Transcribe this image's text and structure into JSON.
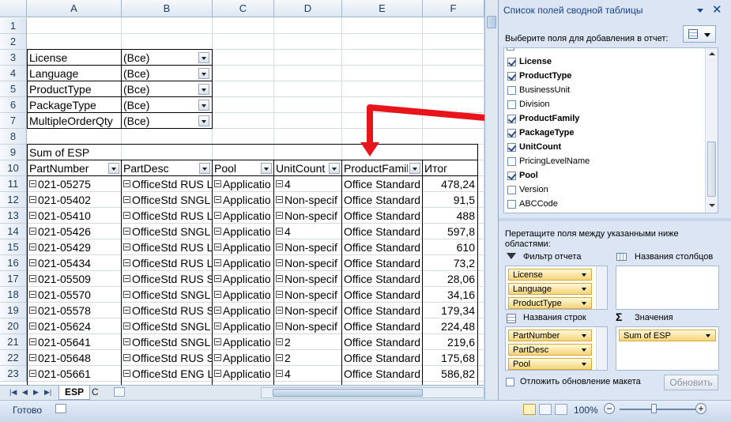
{
  "columns": [
    "A",
    "B",
    "C",
    "D",
    "E",
    "F"
  ],
  "row_numbers": [
    "1",
    "2",
    "3",
    "4",
    "5",
    "6",
    "7",
    "8",
    "9",
    "10",
    "11",
    "12",
    "13",
    "14",
    "15",
    "16",
    "17",
    "18",
    "19",
    "20",
    "21",
    "22",
    "23"
  ],
  "filters": [
    {
      "name": "License",
      "value": "(Все)"
    },
    {
      "name": "Language",
      "value": "(Все)"
    },
    {
      "name": "ProductType",
      "value": "(Все)"
    },
    {
      "name": "PackageType",
      "value": "(Все)"
    },
    {
      "name": "MultipleOrderQty",
      "value": "(Все)"
    }
  ],
  "pivot": {
    "data_caption": "Sum of ESP",
    "headers": [
      "PartNumber",
      "PartDesc",
      "Pool",
      "UnitCount",
      "ProductFamil",
      "Итог"
    ],
    "rows": [
      {
        "part": "021-05275",
        "desc": "OfficeStd RUS Li",
        "pool": "Applicatio",
        "unit": "4",
        "family": "Office Standard",
        "total": "478,24"
      },
      {
        "part": "021-05402",
        "desc": "OfficeStd SNGL I",
        "pool": "Applicatio",
        "unit": "Non-specif",
        "family": "Office Standard",
        "total": "91,5"
      },
      {
        "part": "021-05410",
        "desc": "OfficeStd RUS Li",
        "pool": "Applicatio",
        "unit": "Non-specif",
        "family": "Office Standard",
        "total": "488"
      },
      {
        "part": "021-05426",
        "desc": "OfficeStd SNGL I",
        "pool": "Applicatio",
        "unit": "4",
        "family": "Office Standard",
        "total": "597,8"
      },
      {
        "part": "021-05429",
        "desc": "OfficeStd RUS Li",
        "pool": "Applicatio",
        "unit": "Non-specif",
        "family": "Office Standard",
        "total": "610"
      },
      {
        "part": "021-05434",
        "desc": "OfficeStd RUS Li",
        "pool": "Applicatio",
        "unit": "Non-specif",
        "family": "Office Standard",
        "total": "73,2"
      },
      {
        "part": "021-05509",
        "desc": "OfficeStd RUS SA",
        "pool": "Applicatio",
        "unit": "Non-specif",
        "family": "Office Standard",
        "total": "28,06"
      },
      {
        "part": "021-05570",
        "desc": "OfficeStd SNGL S",
        "pool": "Applicatio",
        "unit": "Non-specif",
        "family": "Office Standard",
        "total": "34,16"
      },
      {
        "part": "021-05578",
        "desc": "OfficeStd RUS SA",
        "pool": "Applicatio",
        "unit": "Non-specif",
        "family": "Office Standard",
        "total": "179,34"
      },
      {
        "part": "021-05624",
        "desc": "OfficeStd SNGL S",
        "pool": "Applicatio",
        "unit": "Non-specif",
        "family": "Office Standard",
        "total": "224,48"
      },
      {
        "part": "021-05641",
        "desc": "OfficeStd SNGL S",
        "pool": "Applicatio",
        "unit": "2",
        "family": "Office Standard",
        "total": "219,6"
      },
      {
        "part": "021-05648",
        "desc": "OfficeStd RUS SA",
        "pool": "Applicatio",
        "unit": "2",
        "family": "Office Standard",
        "total": "175,68"
      },
      {
        "part": "021-05661",
        "desc": "OfficeStd ENG Li",
        "pool": "Applicatio",
        "unit": "4",
        "family": "Office Standard",
        "total": "586,82"
      }
    ]
  },
  "sheet_tabs": {
    "active": "ESP",
    "next": "C"
  },
  "status": {
    "ready": "Готово",
    "zoom": "100%"
  },
  "pane": {
    "title": "Список полей сводной таблицы",
    "choose_label": "Выберите поля для добавления в отчет:",
    "fields": [
      {
        "name": "License",
        "checked": true
      },
      {
        "name": "ProductType",
        "checked": true
      },
      {
        "name": "BusinessUnit",
        "checked": false
      },
      {
        "name": "Division",
        "checked": false
      },
      {
        "name": "ProductFamily",
        "checked": true
      },
      {
        "name": "PackageType",
        "checked": true
      },
      {
        "name": "UnitCount",
        "checked": true
      },
      {
        "name": "PricingLevelName",
        "checked": false
      },
      {
        "name": "Pool",
        "checked": true
      },
      {
        "name": "Version",
        "checked": false
      },
      {
        "name": "ABCCode",
        "checked": false
      }
    ],
    "drag_label": "Перетащите поля между указанными ниже областями:",
    "report_filter_label": "Фильтр отчета",
    "column_labels_label": "Названия столбцов",
    "row_labels_label": "Названия строк",
    "values_label": "Значения",
    "report_filter_items": [
      "License",
      "Language",
      "ProductType"
    ],
    "row_items": [
      "PartNumber",
      "PartDesc",
      "Pool"
    ],
    "value_items": [
      "Sum of ESP"
    ],
    "defer_label": "Отложить обновление макета",
    "update_button": "Обновить"
  },
  "colors": {
    "arrow": "#e8141b",
    "accent": "#15428b"
  },
  "icons": [
    "close-icon",
    "dropdown-icon",
    "layout-icon",
    "filter-icon",
    "columns-icon",
    "rows-icon",
    "sigma-icon",
    "arrow-annotation"
  ]
}
